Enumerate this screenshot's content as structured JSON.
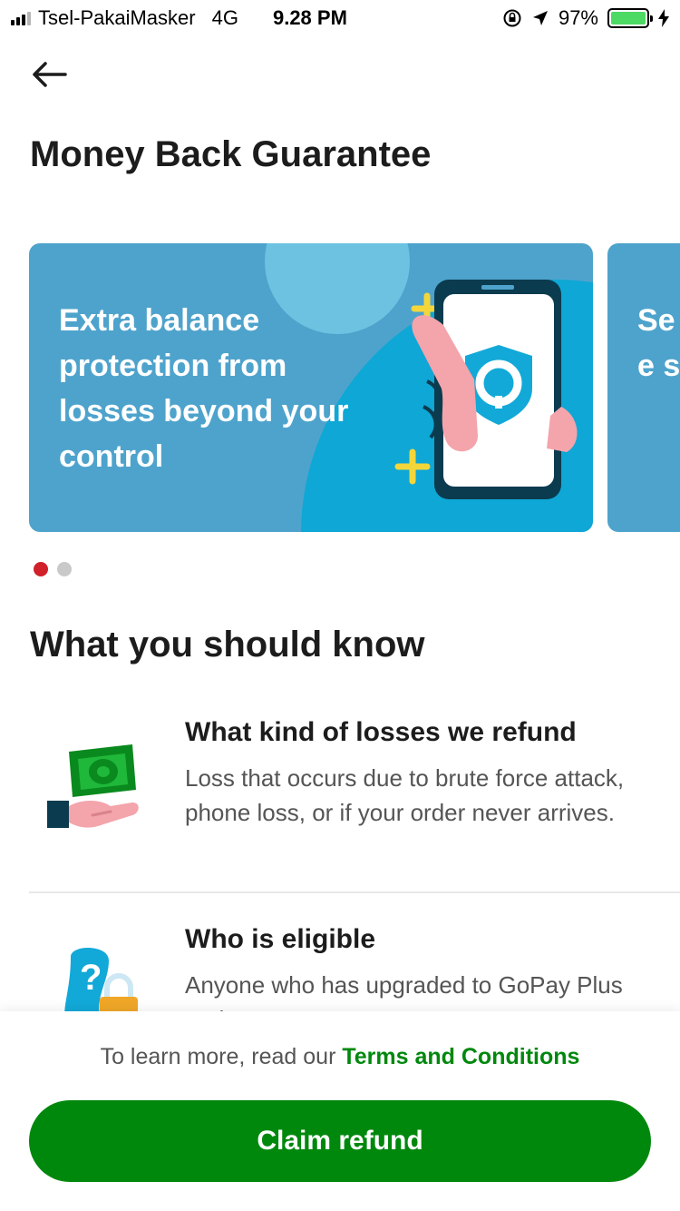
{
  "status_bar": {
    "carrier": "Tsel-PakaiMasker",
    "network": "4G",
    "time": "9.28 PM",
    "battery": "97%",
    "battery_color": "#4cd964"
  },
  "header": {
    "back_icon": "arrow-left-icon",
    "title": "Money Back Guarantee"
  },
  "carousel": {
    "slides": [
      {
        "text": "Extra balance protection from losses beyond your control",
        "illustration": "phone-shield-icon",
        "background": "#4ea3cc"
      },
      {
        "text": "Se ke saf",
        "background": "#4ea3cc"
      }
    ],
    "active_index": 0
  },
  "section": {
    "title": "What you should know",
    "items": [
      {
        "icon": "money-hand-icon",
        "title": "What kind of losses we refund",
        "description": "Loss that occurs due to brute force attack, phone loss, or if your order never arrives."
      },
      {
        "icon": "person-lock-icon",
        "title": "Who is eligible",
        "description": "Anyone who has upgraded to GoPay Plus and set up a PIN"
      }
    ]
  },
  "footer": {
    "learn_more_prefix": "To learn more, read our ",
    "terms_link": "Terms and Conditions",
    "claim_button": "Claim refund",
    "accent_color": "#00880d"
  }
}
